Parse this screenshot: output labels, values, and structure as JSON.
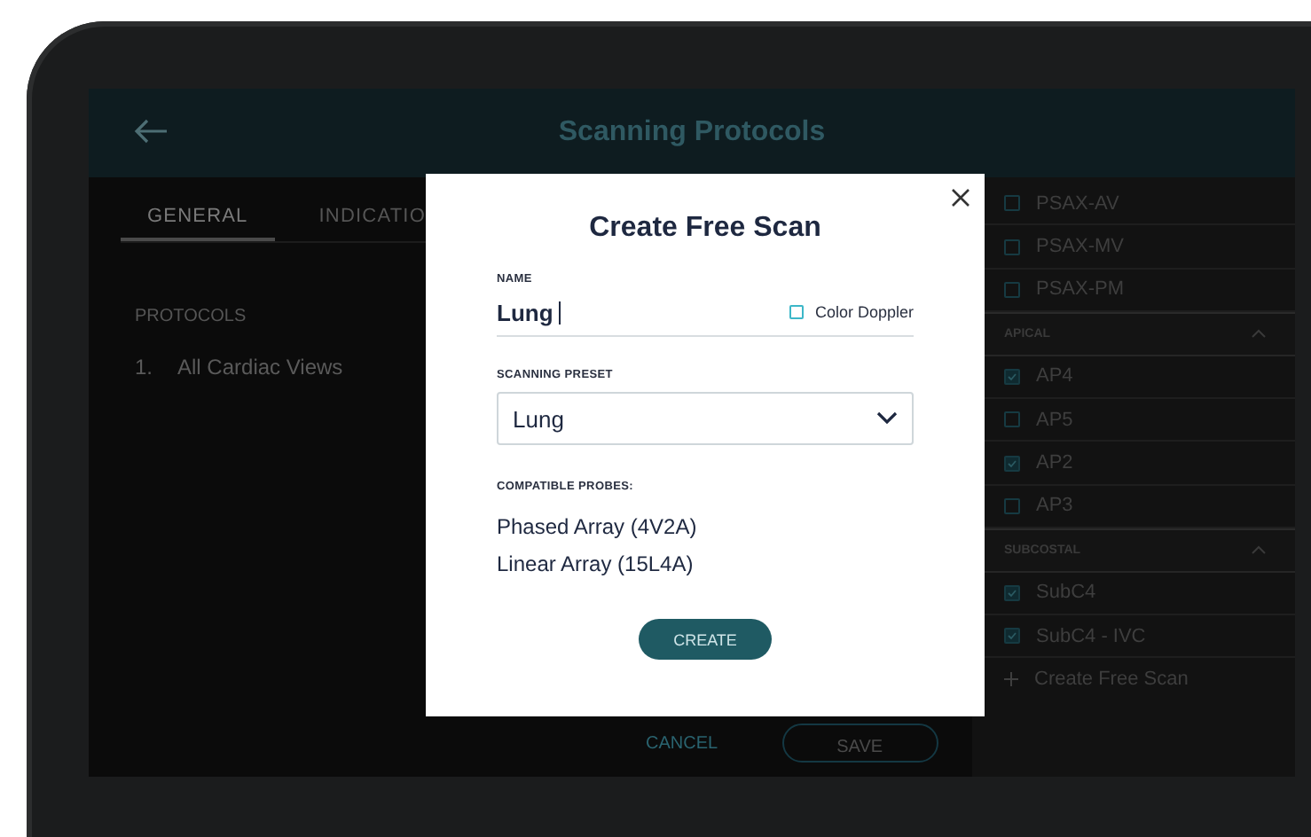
{
  "header": {
    "title": "Scanning Protocols"
  },
  "tabs": [
    {
      "label": "GENERAL",
      "selected": true
    },
    {
      "label": "INDICATIO",
      "selected": false
    }
  ],
  "protocols": {
    "heading": "PROTOCOLS",
    "items": [
      {
        "number": "1.",
        "label": "All Cardiac Views"
      }
    ]
  },
  "actions": {
    "cancel": "CANCEL",
    "save": "SAVE"
  },
  "views": [
    {
      "kind": "item",
      "label": "PSAX-AV",
      "checked": false
    },
    {
      "kind": "item",
      "label": "PSAX-MV",
      "checked": false
    },
    {
      "kind": "item",
      "label": "PSAX-PM",
      "checked": false
    },
    {
      "kind": "section",
      "label": "APICAL",
      "expanded": true
    },
    {
      "kind": "item",
      "label": "AP4",
      "checked": true
    },
    {
      "kind": "item",
      "label": "AP5",
      "checked": false
    },
    {
      "kind": "item",
      "label": "AP2",
      "checked": true
    },
    {
      "kind": "item",
      "label": "AP3",
      "checked": false
    },
    {
      "kind": "section",
      "label": "SUBCOSTAL",
      "expanded": true
    },
    {
      "kind": "item",
      "label": "SubC4",
      "checked": true
    },
    {
      "kind": "item",
      "label": "SubC4 - IVC",
      "checked": true
    },
    {
      "kind": "add",
      "label": "Create Free Scan"
    }
  ],
  "dialog": {
    "title": "Create Free Scan",
    "name_label": "NAME",
    "name_value": "Lung",
    "color_doppler": {
      "label": "Color Doppler",
      "checked": false
    },
    "preset_label": "SCANNING PRESET",
    "preset_value": "Lung",
    "probes_label": "COMPATIBLE PROBES:",
    "probes": [
      "Phased Array (4V2A)",
      "Linear Array (15L4A)"
    ],
    "create": "CREATE"
  }
}
